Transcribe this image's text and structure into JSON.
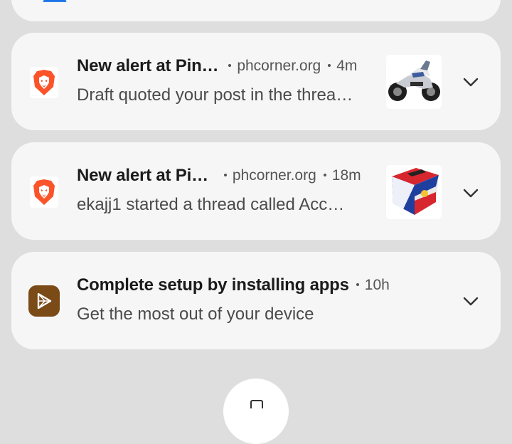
{
  "notifications": [
    {
      "app": "Brave",
      "title": "New alert at Pin…",
      "source": "phcorner.org",
      "time": "4m",
      "text": "Draft quoted your post in the threa…",
      "thumbnail": "motorcycle"
    },
    {
      "app": "Brave",
      "title": "New alert at Pi…",
      "source": "phcorner.org",
      "time": "18m",
      "text": "ekajj1 started a thread called Acc…",
      "thumbnail": "philippine-flag-ballot-box"
    },
    {
      "app": "Play Store setup",
      "title": "Complete setup by installing apps",
      "source": "",
      "time": "10h",
      "text": "Get the most out of your device"
    }
  ],
  "icons": {
    "brave": "brave-lion-icon",
    "setup": "play-triangle-icon",
    "expand": "chevron-down-icon"
  },
  "colors": {
    "background": "#dedede",
    "card": "#f6f6f6",
    "brave_orange": "#fb542b",
    "setup_brown": "#7a4a17",
    "title_text": "#1b1b1b",
    "secondary_text": "#555555"
  }
}
